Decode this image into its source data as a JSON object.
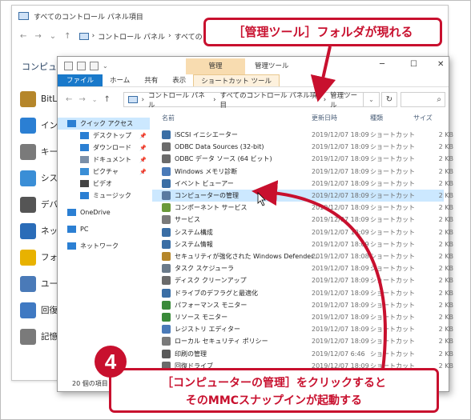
{
  "back_window": {
    "title": "すべてのコントロール パネル項目",
    "breadcrumb": [
      "コントロール パネル",
      "すべてのコントロール パネル項目"
    ],
    "heading": "コンピューターの",
    "items": [
      {
        "label": "BitLo",
        "color": "#b5862a"
      },
      {
        "label": "インタ",
        "color": "#2b7fd3"
      },
      {
        "label": "キーボ",
        "color": "#7a7a7a"
      },
      {
        "label": "システ",
        "color": "#3a8ed6"
      },
      {
        "label": "デバー",
        "color": "#555555"
      },
      {
        "label": "ネット",
        "color": "#2a6cb8"
      },
      {
        "label": "フォン",
        "color": "#e8b200"
      },
      {
        "label": "ユーザ",
        "color": "#4a7ab8"
      },
      {
        "label": "回復",
        "color": "#3f79c2"
      },
      {
        "label": "記憶",
        "color": "#7a7a7a"
      }
    ],
    "status": "20 個の項目"
  },
  "front_window": {
    "contextual_group": "管理",
    "window_title": "管理ツール",
    "ribbon_tabs": [
      "ファイル",
      "ホーム",
      "共有",
      "表示",
      "ショートカット ツール"
    ],
    "breadcrumb": [
      "コントロール パネル",
      "すべてのコントロール パネル項目",
      "管理ツール"
    ],
    "nav": [
      {
        "label": "クイック アクセス",
        "level": 0,
        "selected": true,
        "pinned": false,
        "icon_color": "#2b7fd3"
      },
      {
        "label": "デスクトップ",
        "level": 1,
        "pinned": true,
        "icon_color": "#2b7fd3"
      },
      {
        "label": "ダウンロード",
        "level": 1,
        "pinned": true,
        "icon_color": "#2b7fd3"
      },
      {
        "label": "ドキュメント",
        "level": 1,
        "pinned": true,
        "icon_color": "#7a8fa8"
      },
      {
        "label": "ピクチャ",
        "level": 1,
        "pinned": true,
        "icon_color": "#3a8ed6"
      },
      {
        "label": "ビデオ",
        "level": 1,
        "pinned": false,
        "icon_color": "#444444"
      },
      {
        "label": "ミュージック",
        "level": 1,
        "pinned": false,
        "icon_color": "#2b7fd3"
      },
      {
        "label": "OneDrive",
        "level": 0,
        "pinned": false,
        "icon_color": "#2b7fd3"
      },
      {
        "label": "PC",
        "level": 0,
        "pinned": false,
        "icon_color": "#2b7fd3"
      },
      {
        "label": "ネットワーク",
        "level": 0,
        "pinned": false,
        "icon_color": "#2b7fd3"
      }
    ],
    "columns": [
      "名前",
      "更新日時",
      "種類",
      "サイズ"
    ],
    "files": [
      {
        "name": "iSCSI イニシエーター",
        "date": "2019/12/07 18:09",
        "type": "ショートカット",
        "size": "2 KB",
        "icon_color": "#3a6ea5"
      },
      {
        "name": "ODBC Data Sources (32-bit)",
        "date": "2019/12/07 18:09",
        "type": "ショートカット",
        "size": "2 KB",
        "icon_color": "#6b6b6b"
      },
      {
        "name": "ODBC データ ソース (64 ビット)",
        "date": "2019/12/07 18:09",
        "type": "ショートカット",
        "size": "2 KB",
        "icon_color": "#6b6b6b"
      },
      {
        "name": "Windows メモリ診断",
        "date": "2019/12/07 18:09",
        "type": "ショートカット",
        "size": "2 KB",
        "icon_color": "#4a7ab8"
      },
      {
        "name": "イベント ビューアー",
        "date": "2019/12/07 18:09",
        "type": "ショートカット",
        "size": "2 KB",
        "icon_color": "#3a6ea5"
      },
      {
        "name": "コンピューターの管理",
        "date": "2019/12/07 18:09",
        "type": "ショートカット",
        "size": "2 KB",
        "icon_color": "#5a7aa0",
        "highlighted": true
      },
      {
        "name": "コンポーネント サービス",
        "date": "2019/12/07 18:09",
        "type": "ショートカット",
        "size": "2 KB",
        "icon_color": "#6a9a3a"
      },
      {
        "name": "サービス",
        "date": "2019/12/07 18:09",
        "type": "ショートカット",
        "size": "2 KB",
        "icon_color": "#7a7a7a"
      },
      {
        "name": "システム構成",
        "date": "2019/12/07 18:09",
        "type": "ショートカット",
        "size": "2 KB",
        "icon_color": "#3a6ea5"
      },
      {
        "name": "システム情報",
        "date": "2019/12/07 18:09",
        "type": "ショートカット",
        "size": "2 KB",
        "icon_color": "#3a6ea5"
      },
      {
        "name": "セキュリティが強化された Windows Defender...",
        "date": "2019/12/07 18:08",
        "type": "ショートカット",
        "size": "2 KB",
        "icon_color": "#b5862a"
      },
      {
        "name": "タスク スケジューラ",
        "date": "2019/12/07 18:09",
        "type": "ショートカット",
        "size": "2 KB",
        "icon_color": "#6a7a8a"
      },
      {
        "name": "ディスク クリーンアップ",
        "date": "2019/12/07 18:09",
        "type": "ショートカット",
        "size": "2 KB",
        "icon_color": "#6b6b6b"
      },
      {
        "name": "ドライブのデフラグと最適化",
        "date": "2019/12/07 18:09",
        "type": "ショートカット",
        "size": "2 KB",
        "icon_color": "#3a6ea5"
      },
      {
        "name": "パフォーマンス モニター",
        "date": "2019/12/07 18:09",
        "type": "ショートカット",
        "size": "2 KB",
        "icon_color": "#3a8a3a"
      },
      {
        "name": "リソース モニター",
        "date": "2019/12/07 18:09",
        "type": "ショートカット",
        "size": "2 KB",
        "icon_color": "#3a8a3a"
      },
      {
        "name": "レジストリ エディター",
        "date": "2019/12/07 18:09",
        "type": "ショートカット",
        "size": "2 KB",
        "icon_color": "#4a7ab8"
      },
      {
        "name": "ローカル セキュリティ ポリシー",
        "date": "2019/12/07 18:09",
        "type": "ショートカット",
        "size": "2 KB",
        "icon_color": "#7a7a7a"
      },
      {
        "name": "印刷の管理",
        "date": "2019/12/07 6:46",
        "type": "ショートカット",
        "size": "2 KB",
        "icon_color": "#5a5a5a"
      },
      {
        "name": "回復ドライブ",
        "date": "2019/12/07 18:09",
        "type": "ショートカット",
        "size": "2 KB",
        "icon_color": "#6b6b6b"
      }
    ]
  },
  "annotations": {
    "top": "［管理ツール］フォルダが現れる",
    "step_number": "4",
    "bottom_line1": "［コンピューターの管理］をクリックすると",
    "bottom_line2": "そのMMCスナップインが起動する",
    "accent_color": "#c8102e"
  }
}
